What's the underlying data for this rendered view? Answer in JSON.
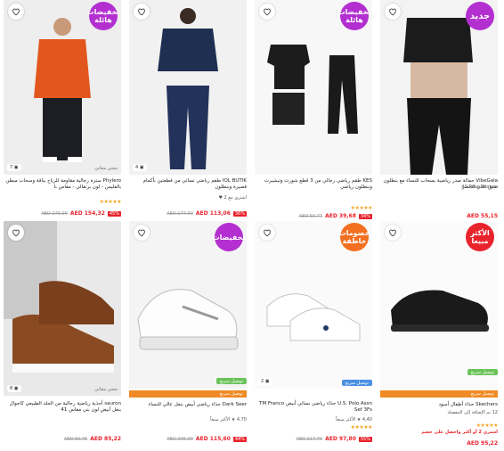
{
  "cards": [
    {
      "id": "card-1",
      "badge": "تخفيضات هائلة",
      "badge_color": "#b32fd0",
      "img_count": "7 ▣",
      "seller_tag": "شحن مجاني",
      "title": "Phylero سترة رجالية مقاومة للرياح بياقة وسحاب مبطن بالفليس - لون برتقالي - مقاس L",
      "stars": "★★★★★",
      "price": "AED 154,32",
      "old": "AED 279,00",
      "disc": "45%"
    },
    {
      "id": "card-2",
      "img_count": "4 ▣",
      "title": "IOL BUTIK طقم رياضي نسائي من قطعتين بأكمام قصيرة وبنطلون",
      "meta": "اشتري مع 2 ♥",
      "price": "AED 113,06",
      "old": "AED 177,00",
      "disc": "36%"
    },
    {
      "id": "card-3",
      "badge": "تخفيضات هائلة",
      "badge_color": "#b32fd0",
      "title": "KES طقم رياضي رجالي من 3 قطع شورت وتيشيرت وبنطلون رياضي",
      "stars": "★★★★★",
      "price": "AED 39,68",
      "old": "AED 59,77",
      "disc": "34%"
    },
    {
      "id": "card-4",
      "badge": "جديد",
      "badge_color": "#b32fd0",
      "title": "VibeGala حمالة صدر رياضية بسحاب للنساء مع بنطلون ضيق عالي الخصر",
      "meta": "AS Rose Women",
      "price": "AED 55,15"
    },
    {
      "id": "card-5",
      "img_count": "8 ▣",
      "seller_tag": "شحن مجاني",
      "title": "sauron أحذية رياضية رجالية من الجلد الطبيعي كاجوال بنعل أبيض لون بني مقاس 41",
      "price": "AED 85,22",
      "old": "AED 99,75"
    },
    {
      "id": "card-6",
      "badge": "تخفيضات",
      "badge_color": "#b32fd0",
      "promo": "توصيل سريع",
      "green": "توصيل سريع",
      "title": "Dark Seer حذاء رياضي أبيض بنعل عالي للنساء",
      "meta": "4,70 ★ الأكثر مبيعاً",
      "price": "AED 115,60",
      "old": "AED 205,00",
      "disc": "44%"
    },
    {
      "id": "card-7",
      "badge": "خصومات خاطفة",
      "badge_color": "#f36f21",
      "blue": "توصيل سريع",
      "img_count": "2 ▣",
      "title": "U.S. Polo Assn حذاء رياضي نسائي أبيض TM Franco Sef 3Fs",
      "meta": "4,40 ★ الأكثر مبيعاً",
      "stars": "★★★★★",
      "price": "AED 97,80",
      "old": "AED 217,79",
      "disc": "55%"
    },
    {
      "id": "card-8",
      "badge": "الأكثر مبيعاً",
      "badge_color": "#e8232c",
      "promo": "توصيل سريع",
      "green": "توصيل سريع",
      "title": "Skechers حذاء أطفال أسود",
      "meta": "12 تم الإضافة إلى المفضلة",
      "stars": "★★★★★",
      "cta": "اشتري 2 أو أكثر واحصل على خصم",
      "price": "AED 95,22"
    }
  ]
}
